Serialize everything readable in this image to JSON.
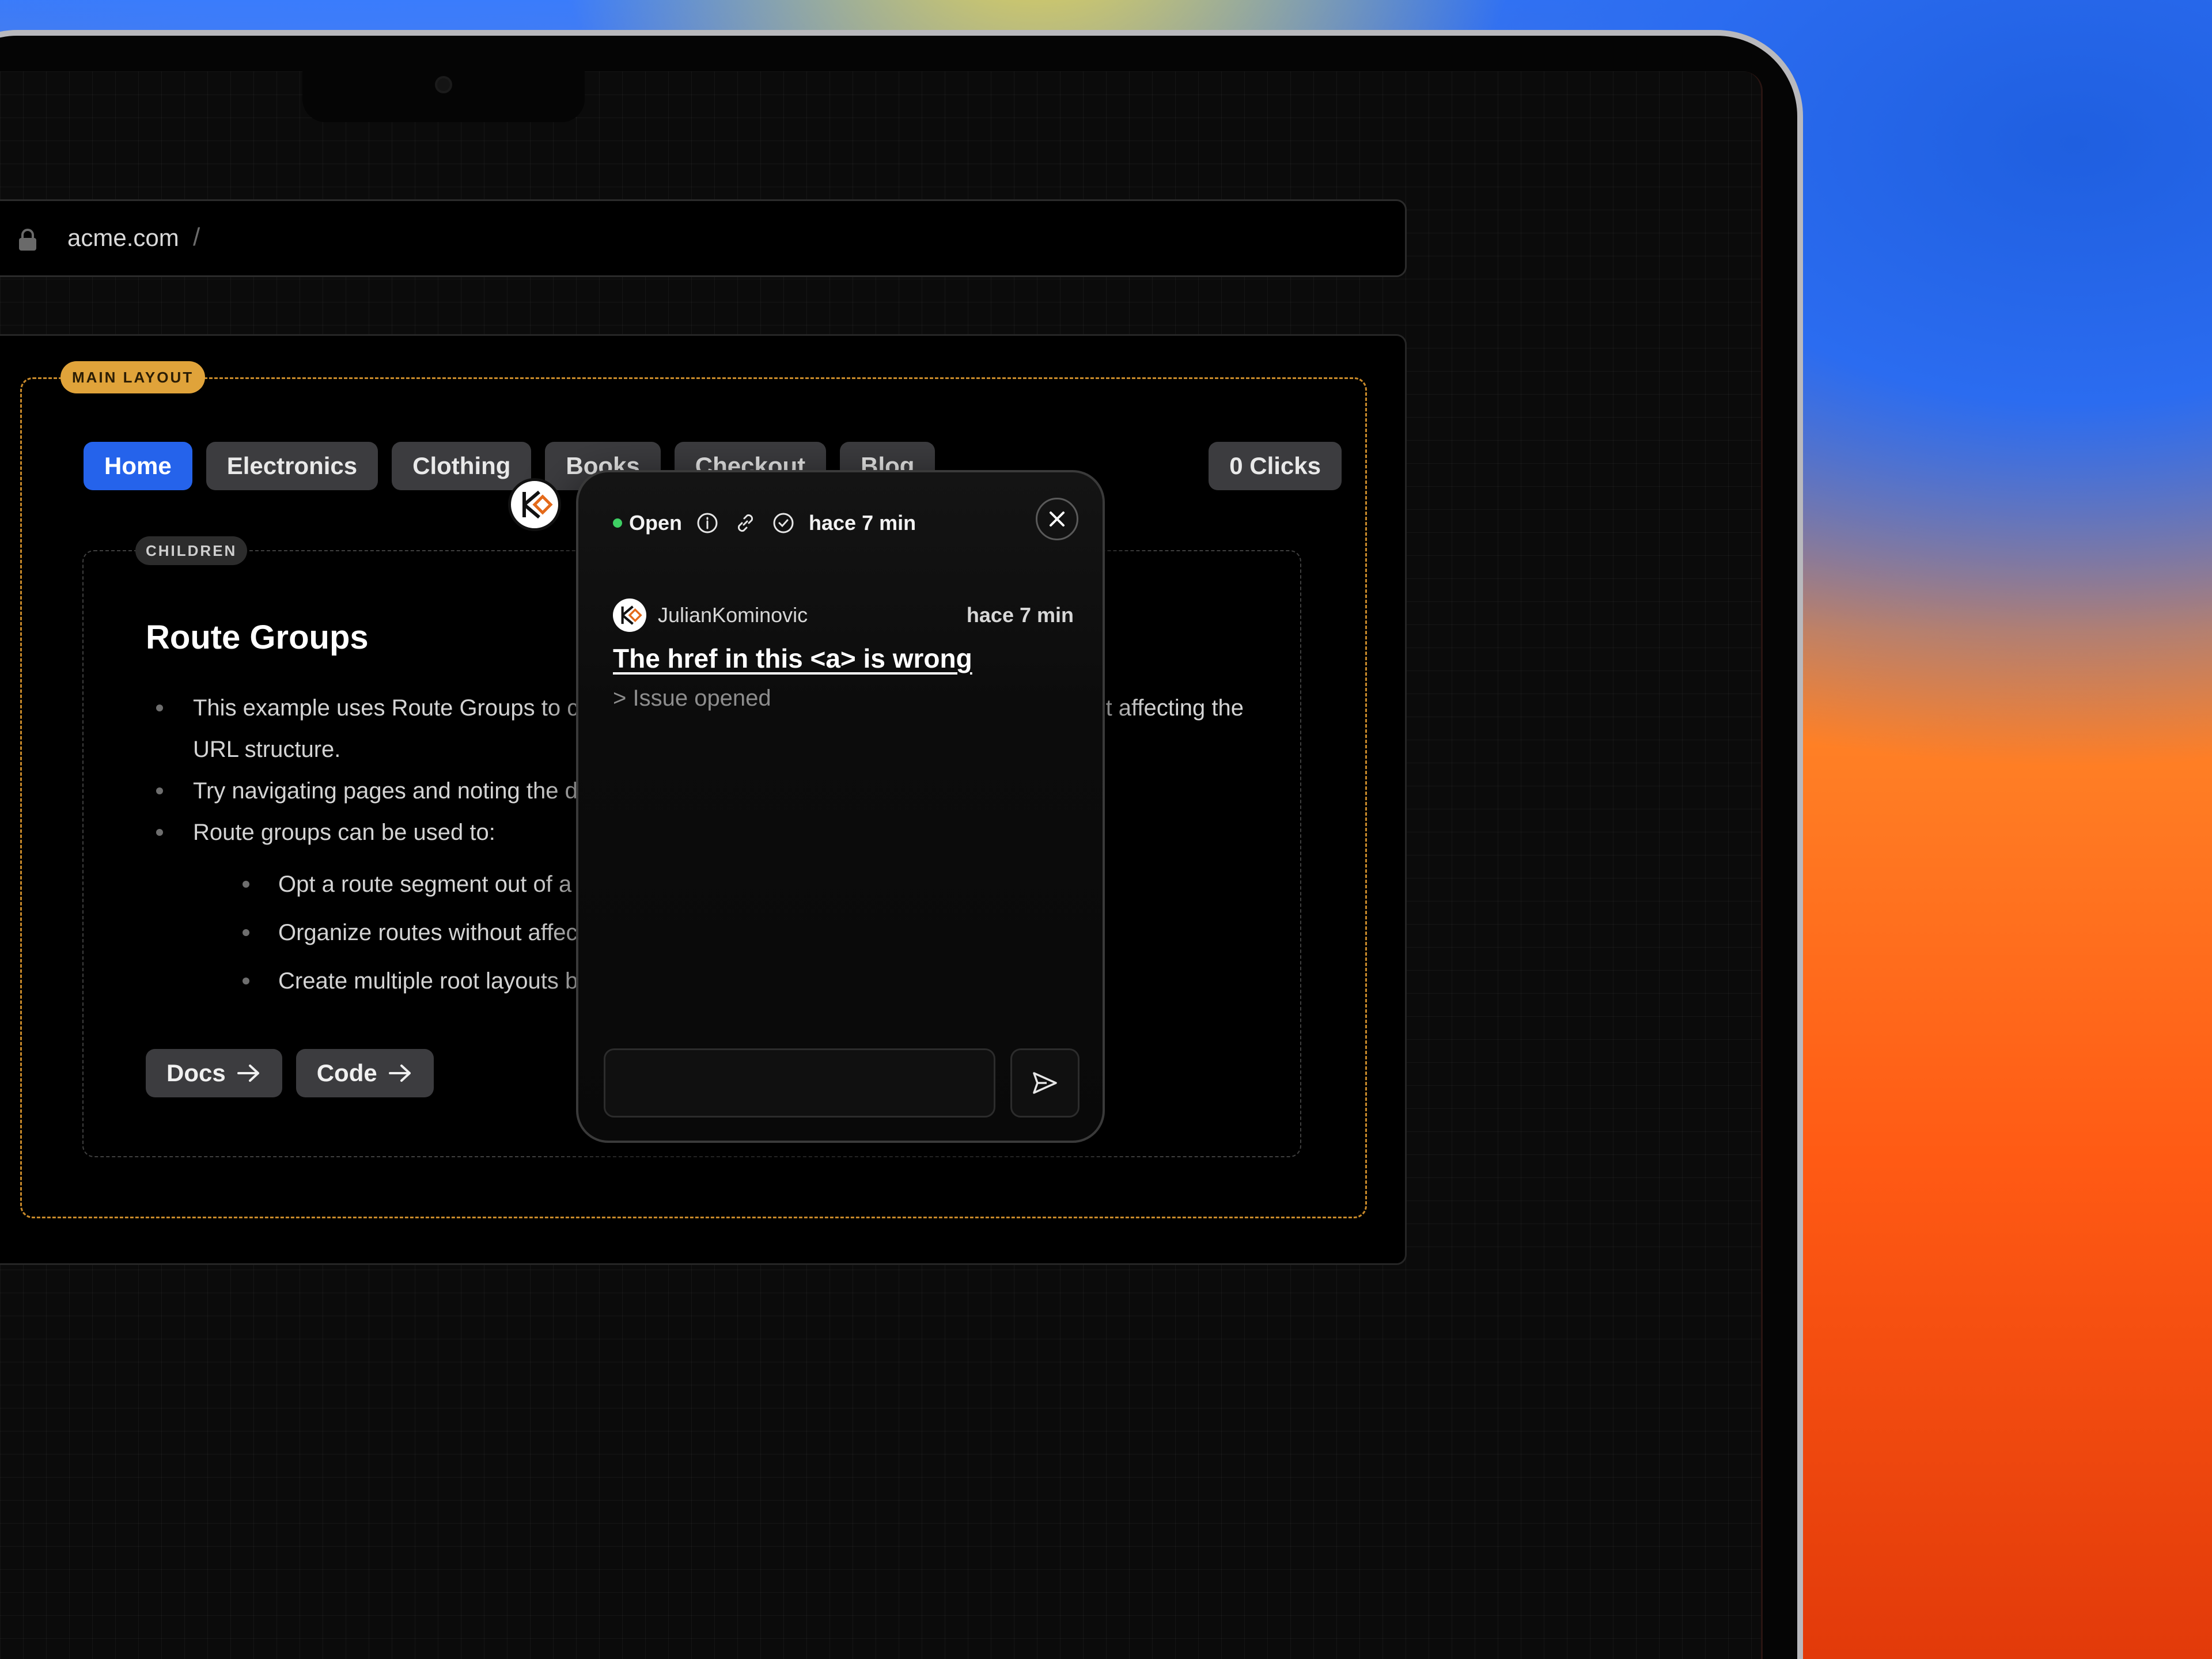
{
  "url": {
    "host": "acme.com",
    "separator": "/"
  },
  "layout": {
    "main_badge": "MAIN LAYOUT",
    "children_badge": "CHILDREN"
  },
  "nav": {
    "items": [
      {
        "label": "Home",
        "active": true
      },
      {
        "label": "Electronics"
      },
      {
        "label": "Clothing"
      },
      {
        "label": "Books"
      },
      {
        "label": "Checkout"
      },
      {
        "label": "Blog"
      }
    ],
    "clicks": "0 Clicks"
  },
  "content": {
    "title": "Route Groups",
    "bullets": [
      "This example uses Route Groups to create layouts for different sections of the app without affecting the URL structure.",
      "Try navigating pages and noting the different layouts used for each section.",
      "Route groups can be used to:"
    ],
    "sub_bullets": [
      "Opt a route segment out of a shared layout.",
      "Organize routes without affecting the URL structure.",
      "Create multiple root layouts by removing the top-level layout."
    ],
    "links": [
      {
        "label": "Docs"
      },
      {
        "label": "Code"
      }
    ]
  },
  "comment": {
    "status": "Open",
    "time": "hace 7 min",
    "author": "JulianKominovic",
    "author_time": "hace 7 min",
    "issue_title": "The href in this <a> is wrong",
    "issue_body": "> Issue opened",
    "reply_placeholder": ""
  },
  "colors": {
    "accent": "#2563eb",
    "status_open": "#3ecf63",
    "main_layout": "#e0a33a"
  }
}
